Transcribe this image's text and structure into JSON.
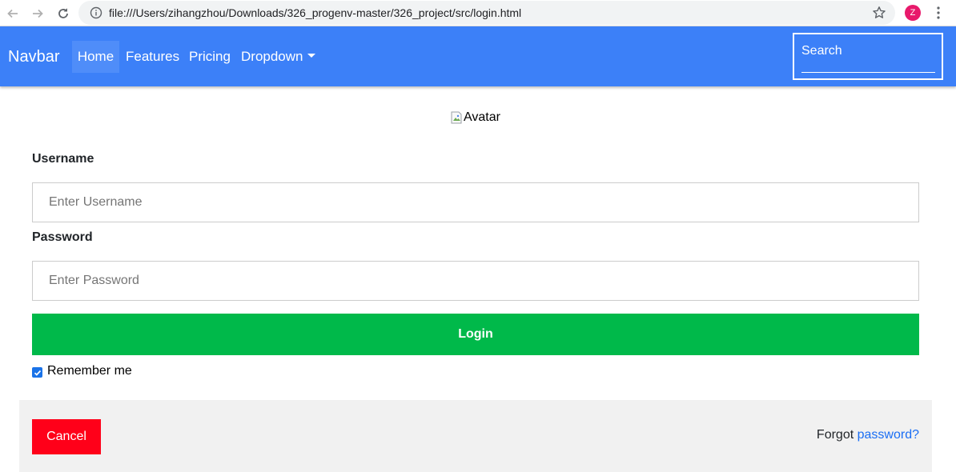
{
  "browser": {
    "url": "file:///Users/zihangzhou/Downloads/326_progenv-master/326_project/src/login.html",
    "profile_initial": "Z",
    "icons": [
      "back-arrow-icon",
      "forward-arrow-icon",
      "reload-icon",
      "info-icon",
      "star-icon",
      "more-vert-icon"
    ]
  },
  "navbar": {
    "brand": "Navbar",
    "links": [
      {
        "label": "Home",
        "active": true
      },
      {
        "label": "Features"
      },
      {
        "label": "Pricing"
      },
      {
        "label": "Dropdown"
      }
    ],
    "search_placeholder": "Search",
    "color": "#3c80f8"
  },
  "form": {
    "avatar_alt": "Avatar",
    "username_label": "Username",
    "username_placeholder": "Enter Username",
    "password_label": "Password",
    "password_placeholder": "Enter Password",
    "login_label": "Login",
    "login_color": "#00b94a",
    "remember_label": "Remember me",
    "remember_checked": true
  },
  "footer": {
    "cancel_label": "Cancel",
    "cancel_color": "#ff0019",
    "forgot_prefix": "Forgot",
    "forgot_link": "password?"
  }
}
